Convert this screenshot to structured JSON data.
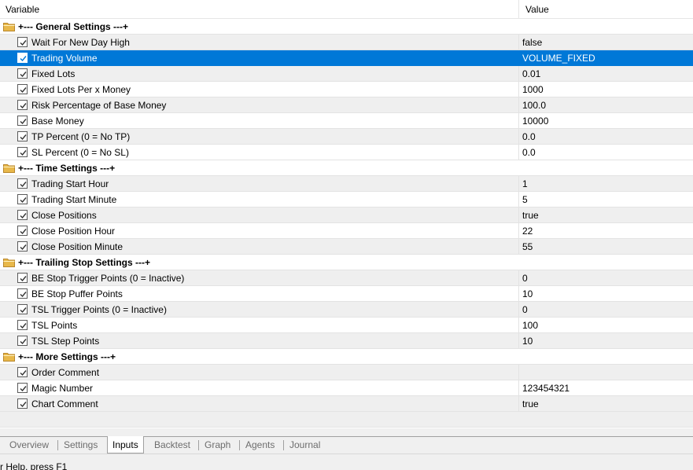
{
  "header": {
    "variable": "Variable",
    "value": "Value"
  },
  "groups": [
    {
      "title": "+--- General Settings ---+",
      "items": [
        {
          "label": "Wait For New Day High",
          "value": "false"
        },
        {
          "label": "Trading Volume",
          "value": "VOLUME_FIXED",
          "selected": true
        },
        {
          "label": "Fixed Lots",
          "value": "0.01"
        },
        {
          "label": "Fixed Lots Per x Money",
          "value": "1000"
        },
        {
          "label": "Risk Percentage of Base Money",
          "value": "100.0"
        },
        {
          "label": "Base Money",
          "value": "10000"
        },
        {
          "label": "TP Percent (0 = No TP)",
          "value": "0.0"
        },
        {
          "label": "SL Percent (0 = No SL)",
          "value": "0.0"
        }
      ]
    },
    {
      "title": "+--- Time Settings ---+",
      "items": [
        {
          "label": "Trading Start Hour",
          "value": "1"
        },
        {
          "label": "Trading Start Minute",
          "value": "5"
        },
        {
          "label": "Close Positions",
          "value": "true"
        },
        {
          "label": "Close Position Hour",
          "value": "22"
        },
        {
          "label": "Close Position Minute",
          "value": "55"
        }
      ]
    },
    {
      "title": "+--- Trailing Stop Settings ---+",
      "items": [
        {
          "label": "BE Stop Trigger Points (0 = Inactive)",
          "value": "0"
        },
        {
          "label": "BE Stop Puffer Points",
          "value": "10"
        },
        {
          "label": "TSL Trigger Points (0 = Inactive)",
          "value": "0"
        },
        {
          "label": "TSL Points",
          "value": "100"
        },
        {
          "label": "TSL Step Points",
          "value": "10"
        }
      ]
    },
    {
      "title": "+--- More Settings ---+",
      "items": [
        {
          "label": "Order Comment",
          "value": ""
        },
        {
          "label": "Magic Number",
          "value": "123454321"
        },
        {
          "label": "Chart Comment",
          "value": "true"
        }
      ]
    }
  ],
  "tabs": [
    {
      "label": "Overview",
      "active": false
    },
    {
      "label": "Settings",
      "active": false
    },
    {
      "label": "Inputs",
      "active": true
    },
    {
      "label": "Backtest",
      "active": false
    },
    {
      "label": "Graph",
      "active": false
    },
    {
      "label": "Agents",
      "active": false
    },
    {
      "label": "Journal",
      "active": false
    }
  ],
  "status": {
    "text": "r Help, press F1"
  },
  "colors": {
    "selected": "#0078d7",
    "alt_row": "#efefef",
    "folder": "#e8b84a"
  },
  "icons": {
    "folder": "folder-icon",
    "check": "checkbox-checked-icon"
  }
}
